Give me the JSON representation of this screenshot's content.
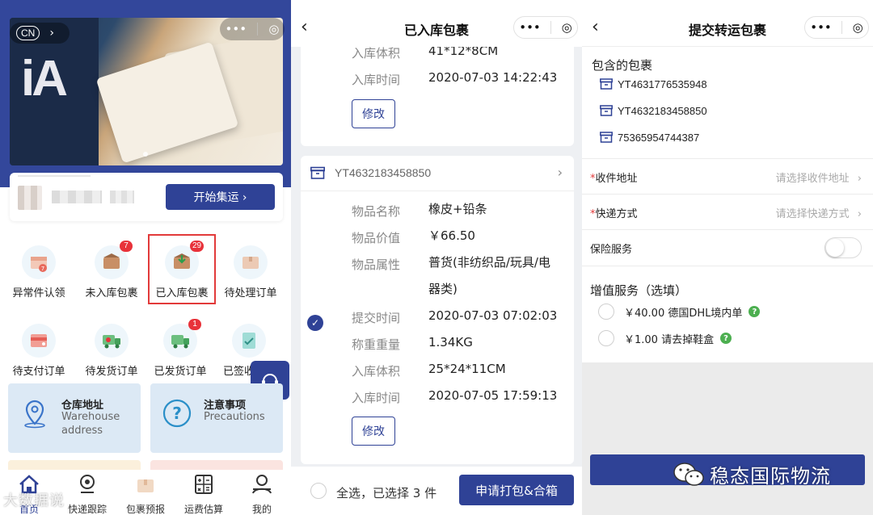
{
  "panel1": {
    "lang_badge": "CN",
    "lang_chevron": "›",
    "capsule": {
      "more": "•••",
      "close": "◎"
    },
    "start_button": "开始集运 ›",
    "grid": [
      {
        "label": "异常件认领",
        "badge": "",
        "icon": "exception-icon",
        "color": "#e86a5c"
      },
      {
        "label": "未入库包裹",
        "badge": "7",
        "icon": "box-icon",
        "color": "#b47a55"
      },
      {
        "label": "已入库包裹",
        "badge": "29",
        "icon": "box-in-icon",
        "color": "#b57d55"
      },
      {
        "label": "待处理订单",
        "badge": "",
        "icon": "box-pending-icon",
        "color": "#d4a78a"
      },
      {
        "label": "待支付订单",
        "badge": "",
        "icon": "wallet-icon",
        "color": "#e55d55"
      },
      {
        "label": "待发货订单",
        "badge": "",
        "icon": "truck-icon",
        "color": "#45a05a"
      },
      {
        "label": "已发货订单",
        "badge": "1",
        "icon": "truck-sent-icon",
        "color": "#43a25b"
      },
      {
        "label": "已签收",
        "badge": "",
        "icon": "signed-icon",
        "color": "#5cb8b0"
      }
    ],
    "info_cards": [
      {
        "title": "仓库地址",
        "subtitle": "Warehouse address"
      },
      {
        "title": "注意事项",
        "subtitle": "Precautions"
      }
    ],
    "tabs": [
      {
        "label": "首页",
        "icon": "home-icon"
      },
      {
        "label": "快递跟踪",
        "icon": "location-icon"
      },
      {
        "label": "包裹预报",
        "icon": "package-icon"
      },
      {
        "label": "运费估算",
        "icon": "calculator-icon"
      },
      {
        "label": "我的",
        "icon": "user-icon"
      }
    ],
    "watermark": "大数据说"
  },
  "panel2": {
    "title": "已入库包裹",
    "back": "‹",
    "capsule": {
      "more": "•••",
      "close": "◎"
    },
    "card1": {
      "rows": [
        {
          "label": "入库体积",
          "value": "41*12*8CM"
        },
        {
          "label": "入库时间",
          "value": "2020-07-03 14:22:43"
        }
      ],
      "edit_label": "修改"
    },
    "card2": {
      "tracking_no": "YT4632183458850",
      "arrow": "›",
      "checked_mark": "✓",
      "rows": [
        {
          "label": "物品名称",
          "value": "橡皮+铅条"
        },
        {
          "label": "物品价值",
          "value": "￥66.50"
        },
        {
          "label": "物品属性",
          "value": "普货(非纺织品/玩具/电器类)"
        },
        {
          "label": "提交时间",
          "value": "2020-07-03 07:02:03"
        },
        {
          "label": "称重重量",
          "value": "1.34KG"
        },
        {
          "label": "入库体积",
          "value": "25*24*11CM"
        },
        {
          "label": "入库时间",
          "value": "2020-07-05 17:59:13"
        }
      ],
      "edit_label": "修改"
    },
    "bottom": {
      "select_text": "全选，已选择 3 件",
      "apply_button": "申请打包&合箱"
    }
  },
  "panel3": {
    "title": "提交转运包裹",
    "back": "‹",
    "capsule": {
      "more": "•••",
      "close": "◎"
    },
    "packages_title": "包含的包裹",
    "packages": [
      "YT4631776535948",
      "YT4632183458850",
      "75365954744387"
    ],
    "address": {
      "label": "收件地址",
      "placeholder": "请选择收件地址",
      "arrow": "›"
    },
    "shipping": {
      "label": "快递方式",
      "placeholder": "请选择快递方式",
      "arrow": "›"
    },
    "insurance_label": "保险服务",
    "insurance_enabled": false,
    "required_mark": "*",
    "vas_title": "增值服务（选填）",
    "vas": [
      {
        "label": "￥40.00 德国DHL境内单"
      },
      {
        "label": "￥1.00 请去掉鞋盒"
      }
    ],
    "q_mark": "?",
    "watermark": "稳态国际物流"
  },
  "colors": {
    "primary": "#2f4296",
    "danger": "#e23a3a",
    "help_green": "#4caf50"
  }
}
